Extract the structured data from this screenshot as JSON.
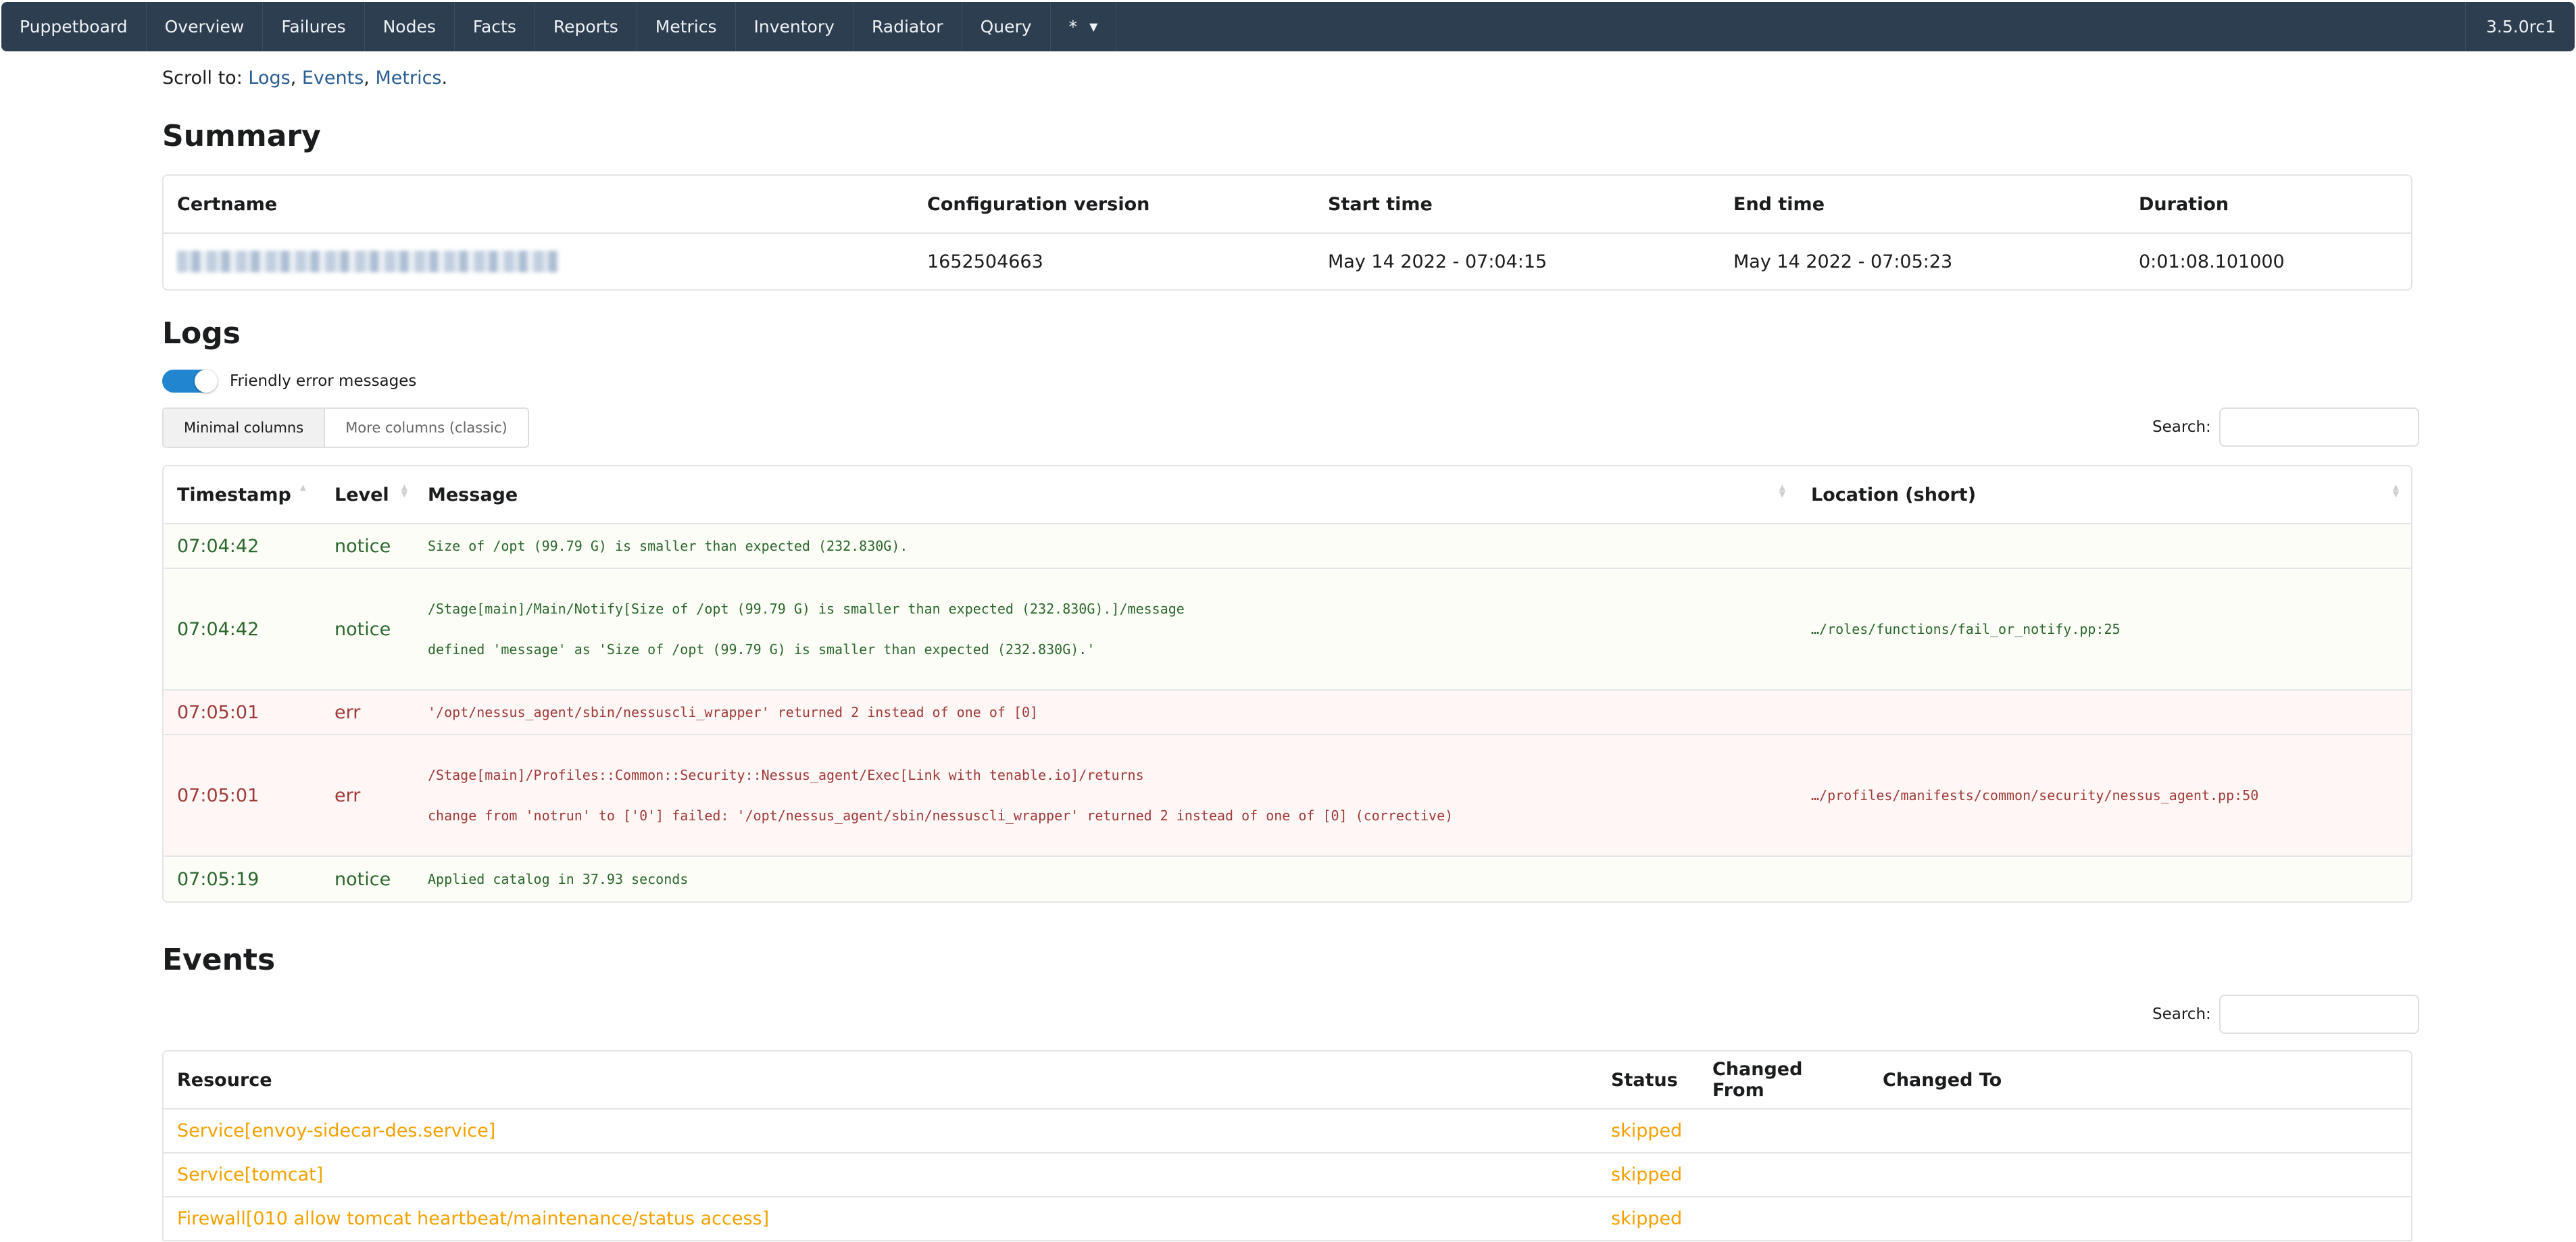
{
  "navbar": {
    "items": [
      "Puppetboard",
      "Overview",
      "Failures",
      "Nodes",
      "Facts",
      "Reports",
      "Metrics",
      "Inventory",
      "Radiator",
      "Query",
      "*"
    ],
    "version": "3.5.0rc1"
  },
  "scroll_to": {
    "label": "Scroll to:",
    "links": [
      "Logs",
      "Events",
      "Metrics"
    ]
  },
  "summary": {
    "title": "Summary",
    "headers": [
      "Certname",
      "Configuration version",
      "Start time",
      "End time",
      "Duration"
    ],
    "row": {
      "certname": "",
      "configuration_version": "1652504663",
      "start_time": "May 14 2022 - 07:04:15",
      "end_time": "May 14 2022 - 07:05:23",
      "duration": "0:01:08.101000"
    }
  },
  "logs": {
    "title": "Logs",
    "friendly_toggle": {
      "label": "Friendly error messages",
      "on": true
    },
    "column_buttons": [
      "Minimal columns",
      "More columns (classic)"
    ],
    "active_column_button": "Minimal columns",
    "search_label": "Search:",
    "search_value": "",
    "headers": [
      "Timestamp",
      "Level",
      "Message",
      "Location (short)"
    ],
    "rows": [
      {
        "timestamp": "07:04:42",
        "level": "notice",
        "message": [
          "Size of /opt (99.79 G) is smaller than expected (232.830G)."
        ],
        "location": ""
      },
      {
        "timestamp": "07:04:42",
        "level": "notice",
        "message": [
          "/Stage[main]/Main/Notify[Size of /opt (99.79 G) is smaller than expected (232.830G).]/message",
          "defined 'message' as 'Size of /opt (99.79 G) is smaller than expected (232.830G).'"
        ],
        "location": "…/roles/functions/fail_or_notify.pp:25"
      },
      {
        "timestamp": "07:05:01",
        "level": "err",
        "message": [
          "'/opt/nessus_agent/sbin/nessuscli_wrapper' returned 2 instead of one of [0]"
        ],
        "location": ""
      },
      {
        "timestamp": "07:05:01",
        "level": "err",
        "message": [
          "/Stage[main]/Profiles::Common::Security::Nessus_agent/Exec[Link with tenable.io]/returns",
          "change from 'notrun' to ['0'] failed: '/opt/nessus_agent/sbin/nessuscli_wrapper' returned 2 instead of one of [0] (corrective)"
        ],
        "location": "…/profiles/manifests/common/security/nessus_agent.pp:50"
      },
      {
        "timestamp": "07:05:19",
        "level": "notice",
        "message": [
          "Applied catalog in 37.93 seconds"
        ],
        "location": ""
      }
    ]
  },
  "events": {
    "title": "Events",
    "search_label": "Search:",
    "search_value": "",
    "headers": [
      "Resource",
      "Status",
      "Changed From",
      "Changed To"
    ],
    "rows": [
      {
        "resource": "Service[envoy-sidecar-des.service]",
        "status": "skipped",
        "changed_from": "",
        "changed_to": ""
      },
      {
        "resource": "Service[tomcat]",
        "status": "skipped",
        "changed_from": "",
        "changed_to": ""
      },
      {
        "resource": "Firewall[010 allow tomcat heartbeat/maintenance/status access]",
        "status": "skipped",
        "changed_from": "",
        "changed_to": ""
      }
    ]
  },
  "colors": {
    "navbar_bg": "#2d3e50",
    "link": "#2a5d94",
    "notice_text": "#2c662d",
    "notice_bg": "#fbfdf6",
    "err_text": "#9f3a38",
    "err_bg": "#fff6f6",
    "skipped": "#f2a100",
    "toggle_on": "#2185d0"
  }
}
